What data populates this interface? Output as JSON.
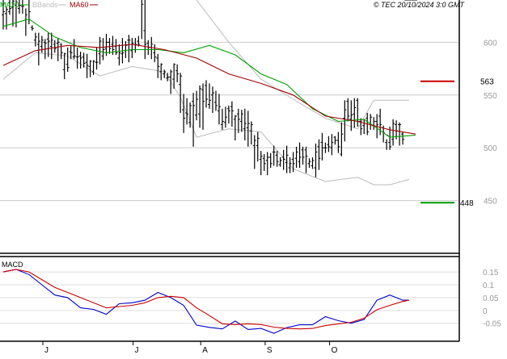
{
  "header": {
    "legend": [
      {
        "label": "MA20",
        "color": "#00a000"
      },
      {
        "label": "BBands",
        "color": "#bbbbbb"
      },
      {
        "label": "MA60",
        "color": "#a00000"
      }
    ],
    "copyright": "© TEC 20/10/2024 3:0 GMT"
  },
  "chart_data": [
    {
      "type": "line",
      "panel": "price",
      "ylim": [
        400,
        640
      ],
      "yticks": [
        "600",
        "550",
        "500",
        "450"
      ],
      "ytick_values": [
        600,
        550,
        500,
        450
      ],
      "xlabels": [
        "J",
        "J",
        "A",
        "S",
        "O"
      ],
      "grid": true,
      "levels": [
        {
          "label": "563",
          "value": 563,
          "color": "#cc0000"
        },
        {
          "label": "448",
          "value": 448,
          "color": "#009900"
        }
      ],
      "series": [
        {
          "name": "MA20",
          "color": "#00a000",
          "x": [
            0,
            8,
            16,
            24,
            32,
            40,
            48,
            56,
            64,
            72,
            80,
            88,
            96,
            104,
            112,
            120,
            128
          ],
          "y": [
            615,
            622,
            605,
            595,
            590,
            593,
            593,
            590,
            597,
            588,
            570,
            560,
            537,
            525,
            527,
            510,
            512
          ]
        },
        {
          "name": "MA60",
          "color": "#a00000",
          "x": [
            0,
            10,
            20,
            30,
            40,
            50,
            60,
            70,
            80,
            90,
            100,
            110,
            120,
            128
          ],
          "y": [
            578,
            592,
            597,
            595,
            598,
            593,
            585,
            570,
            561,
            550,
            530,
            525,
            517,
            513
          ]
        },
        {
          "color": "#bbbbbb",
          "x": [
            0,
            10,
            20,
            30,
            40,
            50,
            55,
            60,
            70,
            80,
            90,
            100,
            110,
            115,
            120,
            126
          ],
          "y": [
            665,
            648,
            650,
            652,
            648,
            655,
            658,
            640,
            600,
            565,
            546,
            528,
            518,
            545,
            545,
            545
          ]
        },
        {
          "color": "#bbbbbb",
          "x": [
            0,
            10,
            20,
            30,
            40,
            50,
            55,
            60,
            70,
            80,
            90,
            100,
            110,
            115,
            120,
            126
          ],
          "y": [
            565,
            590,
            587,
            568,
            577,
            572,
            548,
            510,
            518,
            515,
            480,
            468,
            472,
            465,
            465,
            470
          ]
        }
      ],
      "candles": {
        "x": [
          0,
          1,
          2,
          3,
          4,
          5,
          6,
          7,
          8,
          9,
          10,
          11,
          12,
          13,
          14,
          15,
          16,
          17,
          18,
          19,
          20,
          21,
          22,
          23,
          24,
          25,
          26,
          27,
          28,
          29,
          30,
          31,
          32,
          33,
          34,
          35,
          36,
          37,
          38,
          39,
          40,
          41,
          42,
          43,
          44,
          45,
          46,
          47,
          48,
          49,
          50,
          51,
          52,
          53,
          54,
          55,
          56,
          57,
          58,
          59,
          60,
          61,
          62,
          63,
          64,
          65,
          66,
          67,
          68,
          69,
          70,
          71,
          72,
          73,
          74,
          75,
          76,
          77,
          78,
          79,
          80,
          81,
          82,
          83,
          84,
          85,
          86,
          87,
          88,
          89,
          90,
          91,
          92,
          93,
          94,
          95,
          96,
          97,
          98,
          99,
          100,
          101,
          102,
          103,
          104,
          105,
          106,
          107,
          108,
          109,
          110,
          111,
          112,
          113,
          114,
          115,
          116,
          117,
          118,
          119,
          120,
          121,
          122,
          123,
          124,
          125,
          126,
          127,
          128
        ],
        "high": [
          643,
          634,
          643,
          644,
          647,
          644,
          641,
          632,
          650,
          616,
          609,
          609,
          606,
          603,
          609,
          609,
          602,
          604,
          599,
          590,
          595,
          597,
          603,
          595,
          591,
          590,
          589,
          583,
          583,
          595,
          605,
          604,
          608,
          604,
          606,
          603,
          598,
          604,
          601,
          607,
          604,
          604,
          606,
          653,
          642,
          602,
          605,
          598,
          589,
          580,
          574,
          571,
          574,
          580,
          579,
          571,
          551,
          547,
          543,
          552,
          554,
          559,
          561,
          564,
          561,
          558,
          554,
          551,
          537,
          539,
          540,
          544,
          531,
          537,
          536,
          537,
          535,
          525,
          512,
          515,
          497,
          494,
          496,
          495,
          502,
          497,
          491,
          498,
          502,
          491,
          496,
          501,
          505,
          501,
          501,
          490,
          491,
          504,
          508,
          514,
          505,
          511,
          513,
          511,
          515,
          524,
          545,
          547,
          545,
          547,
          547,
          528,
          527,
          533,
          532,
          529,
          532,
          537,
          521,
          508,
          520,
          527,
          526,
          524,
          515
        ],
        "low": [
          612,
          612,
          626,
          615,
          614,
          627,
          627,
          606,
          617,
          611,
          596,
          578,
          590,
          584,
          586,
          584,
          590,
          582,
          584,
          565,
          572,
          584,
          584,
          575,
          575,
          576,
          566,
          567,
          569,
          574,
          579,
          583,
          587,
          589,
          588,
          588,
          578,
          580,
          585,
          581,
          585,
          590,
          596,
          603,
          584,
          588,
          584,
          581,
          566,
          564,
          566,
          563,
          551,
          556,
          562,
          533,
          514,
          522,
          519,
          501,
          526,
          519,
          517,
          538,
          537,
          533,
          535,
          522,
          517,
          519,
          523,
          520,
          507,
          514,
          515,
          507,
          501,
          503,
          480,
          487,
          474,
          478,
          474,
          481,
          483,
          482,
          482,
          479,
          476,
          476,
          477,
          481,
          481,
          484,
          476,
          481,
          480,
          472,
          479,
          488,
          495,
          496,
          493,
          503,
          495,
          492,
          506,
          525,
          516,
          519,
          520,
          512,
          513,
          512,
          517,
          517,
          509,
          512,
          505,
          498,
          498,
          502,
          508,
          502,
          503
        ],
        "open": [
          626,
          627,
          629,
          633,
          635,
          632,
          634,
          621,
          641,
          614,
          602,
          598,
          596,
          600,
          603,
          596,
          598,
          599,
          598,
          574,
          579,
          591,
          586,
          586,
          587,
          586,
          581,
          577,
          572,
          581,
          589,
          587,
          594,
          600,
          598,
          596,
          585,
          589,
          592,
          602,
          592,
          593,
          601,
          647,
          611,
          599,
          593,
          590,
          585,
          572,
          570,
          566,
          567,
          565,
          573,
          560,
          536,
          533,
          524,
          544,
          531,
          532,
          555,
          559,
          541,
          550,
          543,
          535,
          522,
          524,
          537,
          539,
          527,
          532,
          525,
          518,
          519,
          516,
          502,
          502,
          489,
          490,
          488,
          491,
          496,
          493,
          484,
          491,
          486,
          481,
          489,
          490,
          487,
          498,
          498,
          485,
          483,
          481,
          501,
          505,
          500,
          503,
          500,
          510,
          507,
          494,
          528,
          544,
          527,
          532,
          545,
          525,
          521,
          528,
          522,
          521,
          525,
          530,
          519,
          505,
          505,
          508,
          522,
          522,
          513
        ],
        "close": [
          629,
          631,
          632,
          639,
          638,
          635,
          634,
          626,
          629,
          613,
          605,
          601,
          602,
          599,
          601,
          602,
          594,
          600,
          590,
          589,
          576,
          590,
          587,
          586,
          585,
          580,
          578,
          582,
          582,
          581,
          601,
          593,
          600,
          594,
          593,
          590,
          590,
          590,
          597,
          602,
          599,
          598,
          598,
          636,
          598,
          595,
          598,
          586,
          577,
          579,
          572,
          567,
          572,
          579,
          570,
          568,
          528,
          532,
          540,
          540,
          546,
          556,
          544,
          546,
          545,
          552,
          540,
          539,
          525,
          529,
          535,
          535,
          530,
          527,
          532,
          523,
          523,
          522,
          507,
          509,
          492,
          485,
          491,
          485,
          496,
          487,
          488,
          489,
          493,
          485,
          485,
          496,
          491,
          491,
          492,
          487,
          488,
          496,
          490,
          500,
          500,
          501,
          505,
          507,
          501,
          513,
          536,
          530,
          531,
          538,
          525,
          518,
          523,
          515,
          529,
          525,
          522,
          522,
          514,
          512,
          501,
          523,
          516,
          522,
          508
        ]
      }
    },
    {
      "type": "line",
      "panel": "macd",
      "title": "MACD",
      "ylim": [
        -0.12,
        0.21
      ],
      "yticks": [
        "0.15",
        "0.1",
        "0.05",
        "0",
        "-0.05"
      ],
      "ytick_values": [
        0.15,
        0.1,
        0.05,
        0,
        -0.05
      ],
      "grid": true,
      "series": [
        {
          "name": "MACD",
          "color": "#0000cc",
          "x": [
            0,
            4,
            8,
            12,
            16,
            20,
            24,
            28,
            32,
            36,
            40,
            44,
            48,
            52,
            56,
            60,
            64,
            68,
            72,
            76,
            80,
            84,
            88,
            92,
            96,
            100,
            104,
            108,
            112,
            116,
            120,
            124,
            126
          ],
          "y": [
            0.15,
            0.16,
            0.14,
            0.1,
            0.06,
            0.05,
            0.01,
            0.004,
            -0.015,
            0.026,
            0.03,
            0.04,
            0.07,
            0.05,
            0.02,
            -0.057,
            -0.066,
            -0.072,
            -0.041,
            -0.074,
            -0.07,
            -0.089,
            -0.067,
            -0.056,
            -0.056,
            -0.024,
            -0.04,
            -0.05,
            -0.035,
            0.04,
            0.06,
            0.04,
            0.04
          ]
        },
        {
          "name": "Signal",
          "color": "#cc0000",
          "x": [
            0,
            4,
            8,
            12,
            16,
            20,
            24,
            28,
            32,
            36,
            40,
            44,
            48,
            52,
            56,
            60,
            64,
            68,
            72,
            76,
            80,
            84,
            88,
            92,
            96,
            100,
            104,
            108,
            112,
            116,
            120,
            124,
            126
          ],
          "y": [
            0.15,
            0.16,
            0.15,
            0.12,
            0.09,
            0.07,
            0.05,
            0.03,
            0.01,
            0.015,
            0.02,
            0.03,
            0.05,
            0.055,
            0.05,
            0.01,
            -0.02,
            -0.052,
            -0.055,
            -0.052,
            -0.055,
            -0.065,
            -0.07,
            -0.072,
            -0.07,
            -0.059,
            -0.052,
            -0.046,
            -0.03,
            0.003,
            0.02,
            0.035,
            0.04
          ]
        }
      ]
    }
  ]
}
